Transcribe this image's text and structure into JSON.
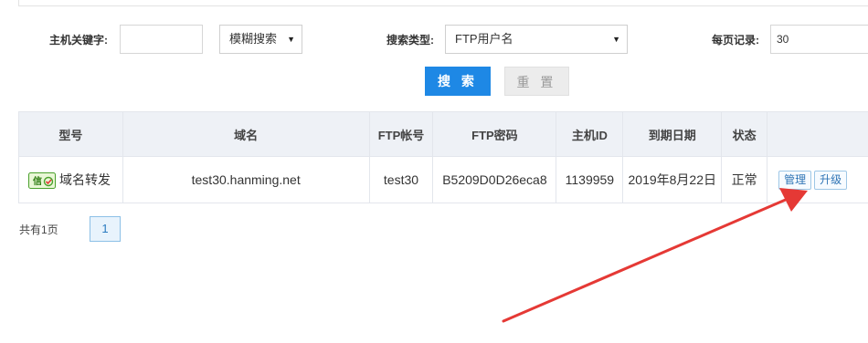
{
  "filters": {
    "keyword_label": "主机关键字:",
    "keyword_value": "",
    "match_mode": "模糊搜索",
    "search_type_label": "搜索类型:",
    "search_type_value": "FTP用户名",
    "per_page_label": "每页记录:",
    "per_page_value": "30"
  },
  "buttons": {
    "search": "搜 索",
    "reset": "重 置"
  },
  "table": {
    "headers": [
      "型号",
      "域名",
      "FTP帐号",
      "FTP密码",
      "主机ID",
      "到期日期",
      "状态",
      ""
    ],
    "rows": [
      {
        "model": "域名转发",
        "domain": "test30.hanming.net",
        "ftp_account": "test30",
        "ftp_password": "B5209D0D26eca8",
        "host_id": "1139959",
        "expiry": "2019年8月22日",
        "status": "正常",
        "action_manage": "管理",
        "action_upgrade": "升级"
      }
    ]
  },
  "pagination": {
    "total": "共有1页",
    "current": "1"
  },
  "icons": {
    "domain_icon": "domain-forward-icon",
    "arrow": "red-arrow-annotation"
  },
  "colors": {
    "primary": "#1e88e5",
    "arrow": "#e53935",
    "header_bg": "#eef1f6"
  }
}
